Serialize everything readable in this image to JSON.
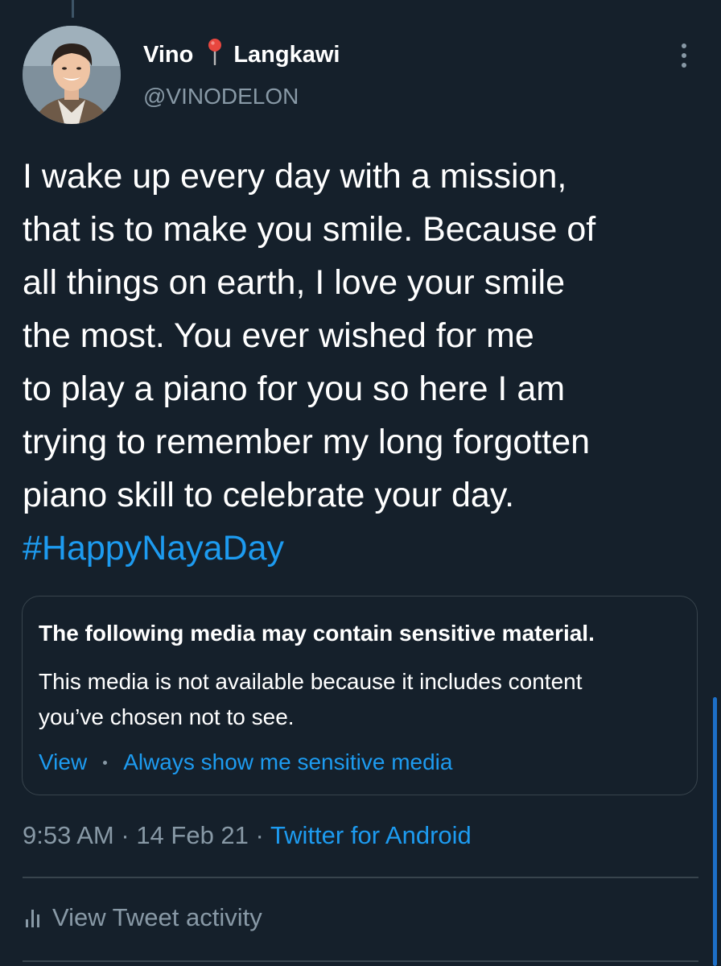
{
  "tweet": {
    "author": {
      "name": "Vino",
      "location_icon": "round-pushpin-icon",
      "location": "Langkawi",
      "handle": "@VINODELON"
    },
    "text_lines": [
      "I wake up every day with a mission,",
      "that is to make you smile. Because of",
      "all things on earth, I love your smile",
      "the most. You ever wished for me",
      "to play a piano for you so here I am",
      "trying to remember my long forgotten",
      "piano skill to celebrate your day."
    ],
    "hashtag": "#HappyNayaDay",
    "sensitive_media": {
      "title": "The following media may contain sensitive material.",
      "body_lines": [
        "This media is not available because it includes content",
        "you’ve chosen not to see."
      ],
      "view_label": "View",
      "always_show_label": "Always show me sensitive media"
    },
    "time": "9:53 AM",
    "date": "14 Feb 21",
    "source": "Twitter for Android",
    "activity_label": "View Tweet activity"
  },
  "colors": {
    "background": "#15202b",
    "accent": "#1d9bf0",
    "secondary_text": "#8899a6",
    "border": "#38444d"
  }
}
